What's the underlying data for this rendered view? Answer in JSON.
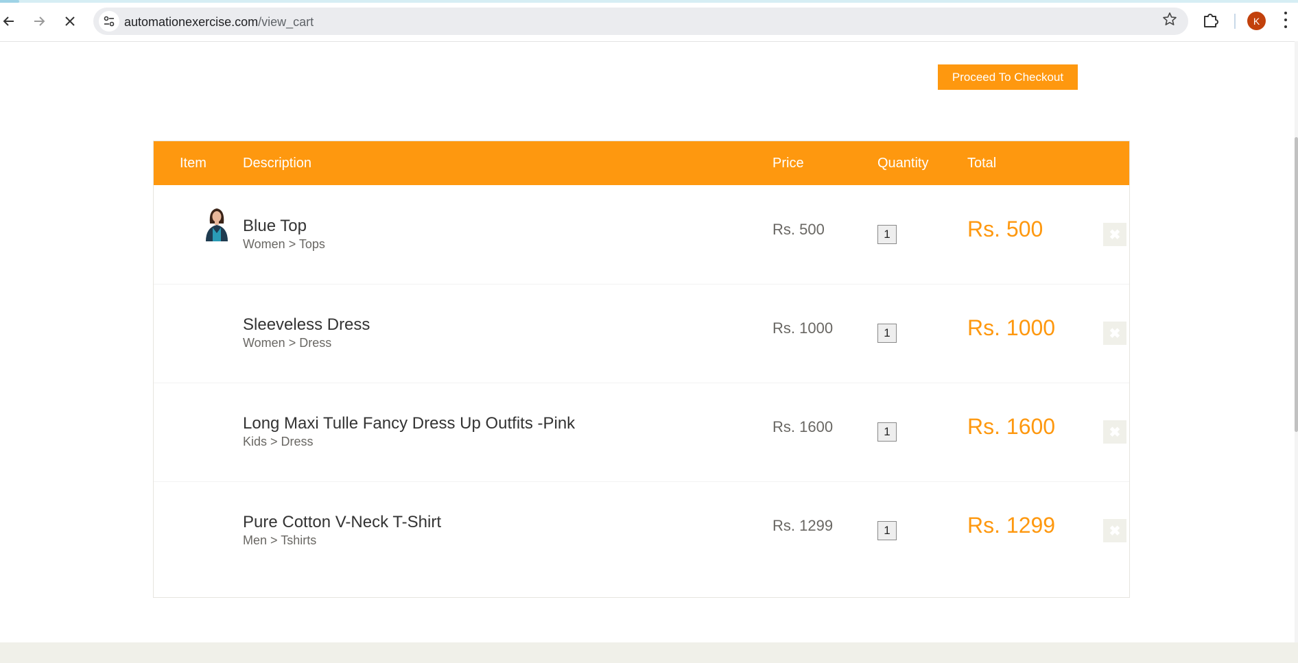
{
  "browser": {
    "url_domain": "automationexercise.com",
    "url_path": "/view_cart",
    "profile_initial": "K",
    "icons": {
      "back": "arrow-left-icon",
      "forward": "arrow-right-icon",
      "stop": "close-icon",
      "site_info": "tune-icon",
      "bookmark": "star-icon",
      "extensions": "puzzle-icon",
      "menu": "kebab-menu-icon"
    }
  },
  "page": {
    "checkout_label": "Proceed To Checkout",
    "accent_color": "#fe980f"
  },
  "cart": {
    "headers": {
      "item": "Item",
      "description": "Description",
      "price": "Price",
      "quantity": "Quantity",
      "total": "Total"
    },
    "rows": [
      {
        "name": "Blue Top",
        "category": "Women > Tops",
        "price": "Rs. 500",
        "quantity": "1",
        "total": "Rs. 500",
        "has_image": true
      },
      {
        "name": "Sleeveless Dress",
        "category": "Women > Dress",
        "price": "Rs. 1000",
        "quantity": "1",
        "total": "Rs. 1000",
        "has_image": false
      },
      {
        "name": "Long Maxi Tulle Fancy Dress Up Outfits -Pink",
        "category": "Kids > Dress",
        "price": "Rs. 1600",
        "quantity": "1",
        "total": "Rs. 1600",
        "has_image": false
      },
      {
        "name": "Pure Cotton V-Neck T-Shirt",
        "category": "Men > Tshirts",
        "price": "Rs. 1299",
        "quantity": "1",
        "total": "Rs. 1299",
        "has_image": false
      }
    ],
    "delete_icon": "close-icon"
  }
}
